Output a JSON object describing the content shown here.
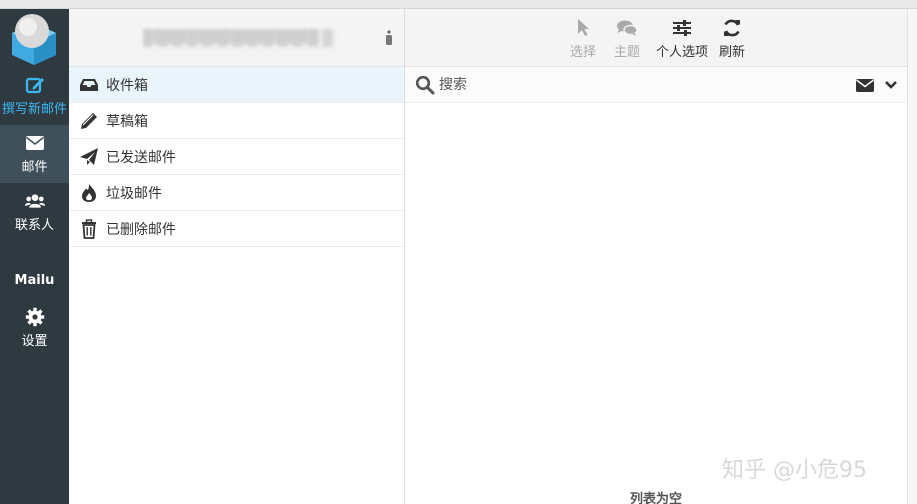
{
  "nav": {
    "compose_label": "撰写新邮件",
    "mail_label": "邮件",
    "contacts_label": "联系人",
    "brand": "Mailu",
    "settings_label": "设置"
  },
  "account": {
    "name": "████████████████"
  },
  "folders": [
    {
      "label": "收件箱",
      "icon": "inbox-icon",
      "active": true
    },
    {
      "label": "草稿箱",
      "icon": "pencil-icon",
      "active": false
    },
    {
      "label": "已发送邮件",
      "icon": "paper-plane-icon",
      "active": false
    },
    {
      "label": "垃圾邮件",
      "icon": "fire-icon",
      "active": false
    },
    {
      "label": "已删除邮件",
      "icon": "trash-icon",
      "active": false
    }
  ],
  "toolbar": {
    "select_label": "选择",
    "thread_label": "主题",
    "options_label": "个人选项",
    "refresh_label": "刷新"
  },
  "search": {
    "placeholder": "搜索"
  },
  "message_list": {
    "empty_text": "列表为空"
  },
  "watermark": "知乎 @小危95",
  "colors": {
    "nav_bg": "#2f3a40",
    "nav_active_bg": "#40505a",
    "compose_accent": "#3ab7f0",
    "active_folder_bg": "#e9f4fb"
  }
}
